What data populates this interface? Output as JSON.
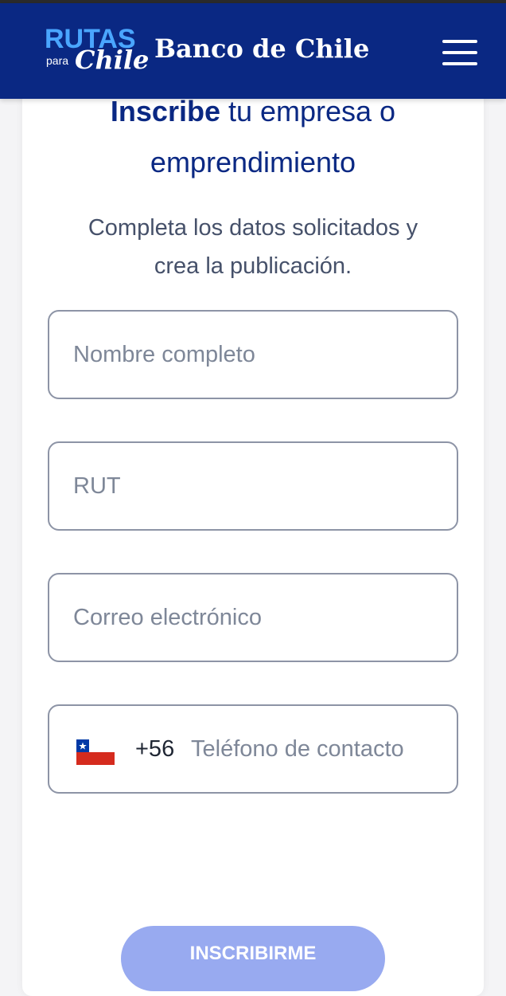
{
  "header": {
    "logo_rutas_top": "RUTAS",
    "logo_rutas_para": "para",
    "logo_rutas_chile": "Chile",
    "logo_banco": "Banco de Chile",
    "background_color": "#0a2883",
    "menu_icon": "hamburger-menu-icon"
  },
  "form": {
    "title_bold": "Inscribe",
    "title_rest": " tu empresa o",
    "title_line2": "emprendimiento",
    "subtitle_line1": "Completa los datos solicitados y",
    "subtitle_line2": "crea la publicación.",
    "fields": {
      "name_placeholder": "Nombre completo",
      "rut_placeholder": "RUT",
      "email_placeholder": "Correo electrónico",
      "phone_prefix": "+56",
      "phone_placeholder": "Teléfono de contacto",
      "phone_flag": "chile-flag-icon"
    },
    "submit_label": "INSCRIBIRME",
    "submit_color": "#98aaf0"
  }
}
